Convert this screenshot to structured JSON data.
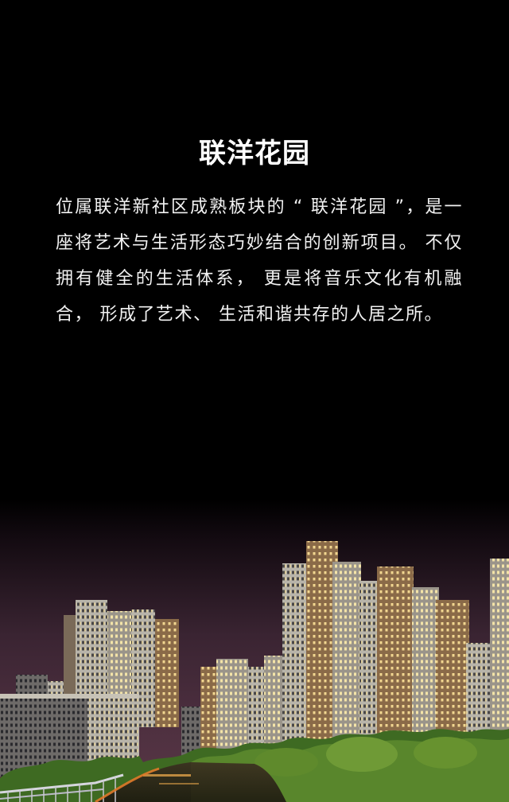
{
  "page": {
    "title": "联洋花园",
    "intro": "位属联洋新社区成熟板块的 “ 联洋花园 ”，是一座将艺术与生活形态巧妙结合的创新项目。 不仅拥有健全的生活体系， 更是将音乐文化有机融合， 形成了艺术、 生活和谐共存的人居之所。"
  },
  "colors": {
    "background": "#000000",
    "text": "#ffffff",
    "sky_bottom": "#4a2c3a",
    "building_lit": "#d9c9a0",
    "building_brown": "#8a6a4a",
    "trees": "#4e7a2c",
    "railing": "#c8c8d0"
  },
  "photo": {
    "subject": "night-skyline-photo"
  }
}
